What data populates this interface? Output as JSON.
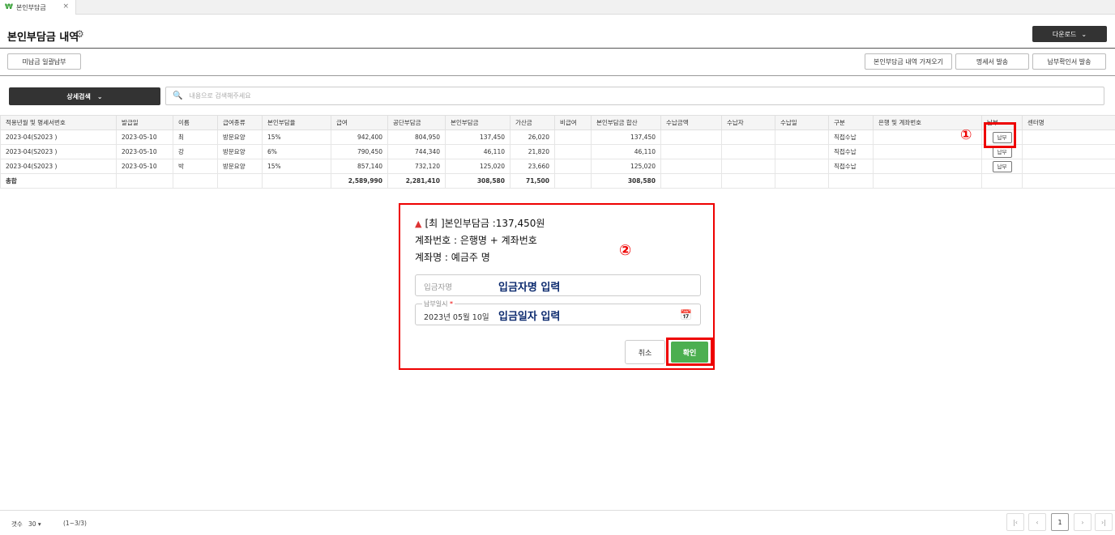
{
  "tab": {
    "icon": "₩",
    "label": "본인부담금",
    "close": "×"
  },
  "header": {
    "title": "본인부담금 내역",
    "gear": "⚙",
    "download_label": "다운로드",
    "download_caret": "⌄"
  },
  "toolbar": {
    "unpaid_bulk": "미납금 일괄납부",
    "import_label": "본인부담금 내역 가져오기",
    "statement_label": "명세서 발송",
    "confirm_label": "납부확인서 발송"
  },
  "search": {
    "button_label": "상세검색",
    "caret": "⌄",
    "icon": "🔍",
    "placeholder": "내용으로 검색해주세요"
  },
  "table": {
    "columns": [
      "적용년월 및 명세서번호",
      "발급일",
      "이름",
      "급여종류",
      "본인부담율",
      "급여",
      "공단부담금",
      "본인부담금",
      "가산금",
      "비급여",
      "본인부담금 합산",
      "수납금액",
      "수납자",
      "수납일",
      "구분",
      "은행 및 계좌번호",
      "납부",
      "센터명"
    ],
    "rows": [
      [
        "2023-04(S2023            )",
        "2023-05-10",
        "최",
        "방문요양",
        "15%",
        "942,400",
        "804,950",
        "137,450",
        "26,020",
        "",
        "137,450",
        "",
        "",
        "",
        "직접수납",
        "",
        "납부",
        ""
      ],
      [
        "2023-04(S2023            )",
        "2023-05-10",
        "강",
        "방문요양",
        "6%",
        "790,450",
        "744,340",
        "46,110",
        "21,820",
        "",
        "46,110",
        "",
        "",
        "",
        "직접수납",
        "",
        "납부",
        ""
      ],
      [
        "2023-04(S2023            )",
        "2023-05-10",
        "박",
        "방문요양",
        "15%",
        "857,140",
        "732,120",
        "125,020",
        "23,660",
        "",
        "125,020",
        "",
        "",
        "",
        "직접수납",
        "",
        "납부",
        ""
      ]
    ],
    "total": [
      "총합",
      "",
      "",
      "",
      "",
      "2,589,990",
      "2,281,410",
      "308,580",
      "71,500",
      "",
      "308,580",
      "",
      "",
      "",
      "",
      "",
      "",
      ""
    ]
  },
  "annotations": {
    "marker1": "①",
    "marker2": "②"
  },
  "modal": {
    "warning_icon": "▲",
    "line1": "[최       ]본인부담금 :137,450원",
    "line2": "계좌번호 : 은행명 + 계좌번호",
    "line3": "계좌명 :  예금주 명",
    "depositor_placeholder": "입금자명",
    "depositor_hint": "입금자명 입력",
    "date_legend": "납부일시",
    "date_required": "*",
    "date_value": "2023년 05월 10일",
    "date_hint": "입금일자 입력",
    "calendar_icon": "📅",
    "cancel_label": "취소",
    "ok_label": "확인"
  },
  "footer": {
    "rows_label": "갯수",
    "rows_value": "30",
    "rows_caret": "▾",
    "range": "(1~3/3)",
    "first": "|‹",
    "prev": "‹",
    "page": "1",
    "next": "›",
    "last": "›|"
  }
}
